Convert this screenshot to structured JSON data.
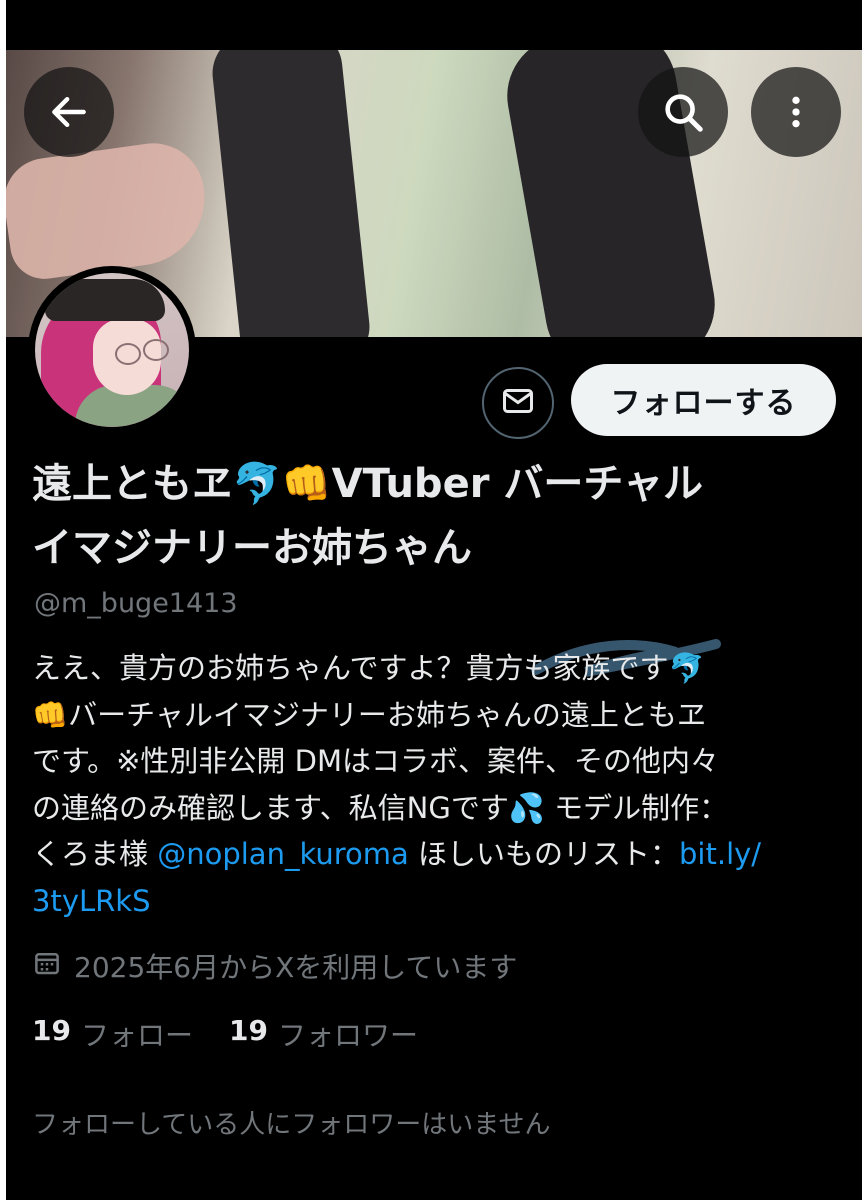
{
  "header": {
    "back_icon": "arrow-left-icon",
    "search_icon": "search-icon",
    "more_icon": "more-vertical-icon"
  },
  "profile": {
    "name_line1": "遠上ともヱ🐬👊VTuber バーチャル",
    "name_line2": "イマジナリーお姉ちゃん",
    "handle": "@m_buge1413",
    "follow_label": "フォローする",
    "message_icon": "mail-icon"
  },
  "bio": {
    "line1": "ええ、貴方のお姉ちゃんですよ？貴方も家族です🐬",
    "line2": "👊バーチャルイマジナリーお姉ちゃんの遠上ともヱ",
    "line3": "です。※性別非公開 DMはコラボ、案件、その他内々",
    "line4": "の連絡のみ確認します、私信NGです💦 モデル制作：",
    "line5_prefix": "くろま様 ",
    "line5_mention": "@noplan_kuroma",
    "line5_mid": " ほしいものリスト：",
    "line5_link": "bit.ly/",
    "line6_link": "3tyLRkS"
  },
  "meta": {
    "joined_icon": "calendar-icon",
    "joined": "2025年6月からXを利用しています"
  },
  "stats": {
    "following_count": "19",
    "following_label": "フォロー",
    "followers_count": "19",
    "followers_label": "フォロワー"
  },
  "footer": {
    "no_mutual_followers": "フォローしている人にフォロワーはいません"
  }
}
